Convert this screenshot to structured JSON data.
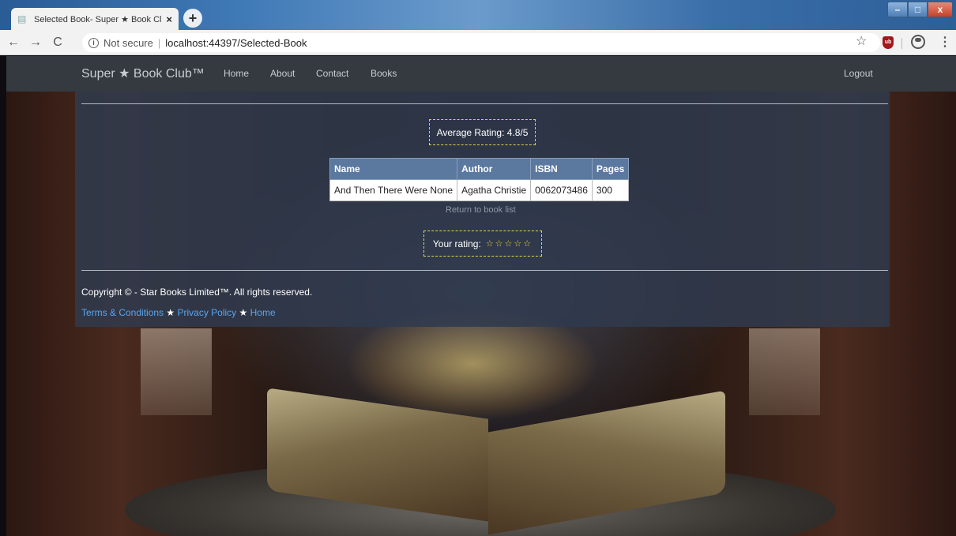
{
  "browser": {
    "tab_title": "Selected Book- Super ★ Book Cl",
    "tab_close": "×",
    "new_tab": "+",
    "security": "Not secure",
    "separator": "|",
    "url": "localhost:44397/Selected-Book",
    "back": "←",
    "forward": "→",
    "reload": "C",
    "bookmark_star": "☆",
    "extension": "ub",
    "menu": "⋮",
    "window_min": "–",
    "window_max": "□",
    "window_close": "x"
  },
  "navbar": {
    "brand": "Super ★ Book Club™",
    "links": [
      "Home",
      "About",
      "Contact",
      "Books"
    ],
    "logout": "Logout"
  },
  "book": {
    "average_rating_label": "Average Rating: 4.8/5",
    "columns": [
      "Name",
      "Author",
      "ISBN",
      "Pages"
    ],
    "rows": [
      [
        "And Then There Were None",
        "Agatha Christie",
        "0062073486",
        "300"
      ]
    ],
    "return_link": "Return to book list",
    "your_rating_label": "Your rating:",
    "your_rating_stars": "☆☆☆☆☆"
  },
  "footer": {
    "copyright": "Copyright © - Star Books Limited™. All rights reserved.",
    "links": [
      "Terms & Conditions",
      "Privacy Policy",
      "Home"
    ],
    "separator": "★"
  },
  "colors": {
    "navbar": "#343a40",
    "table_header": "#5b789f",
    "accent_border": "#e6d34a",
    "link": "#58a6f0"
  }
}
